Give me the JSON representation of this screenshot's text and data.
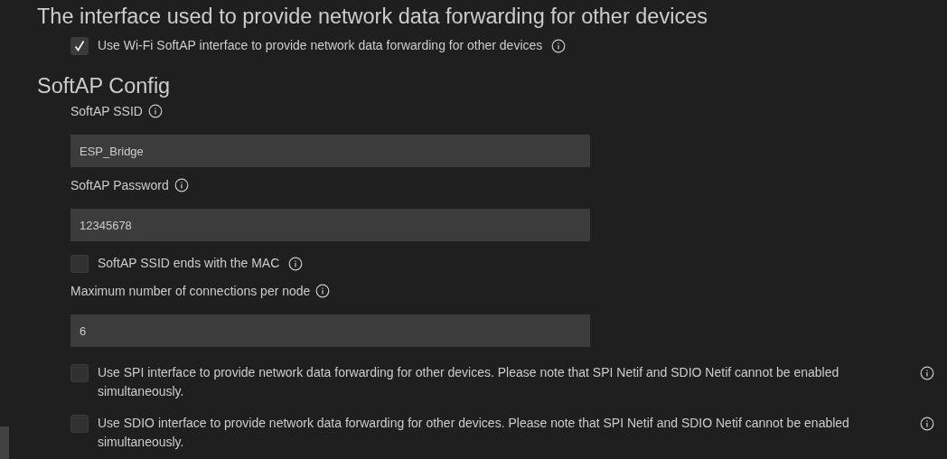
{
  "sections": [
    {
      "heading": "The interface used to provide network data forwarding for other devices",
      "items": [
        {
          "kind": "checkbox",
          "label": "Use Wi-Fi SoftAP interface to provide network data forwarding for other devices",
          "checked": true
        }
      ]
    },
    {
      "heading": "SoftAP Config",
      "items": [
        {
          "kind": "text",
          "label": "SoftAP SSID",
          "value": "ESP_Bridge"
        },
        {
          "kind": "text",
          "label": "SoftAP Password",
          "value": "12345678"
        },
        {
          "kind": "checkbox",
          "label": "SoftAP SSID ends with the MAC",
          "checked": false
        },
        {
          "kind": "text",
          "label": "Maximum number of connections per node",
          "value": "6"
        },
        {
          "kind": "checkbox",
          "label": "Use SPI interface to provide network data forwarding for other devices. Please note that SPI Netif and SDIO Netif cannot be enabled simultaneously.",
          "checked": false,
          "wide": true
        },
        {
          "kind": "checkbox",
          "label": "Use SDIO interface to provide network data forwarding for other devices. Please note that SPI Netif and SDIO Netif cannot be enabled simultaneously.",
          "checked": false,
          "wide": true
        }
      ]
    }
  ]
}
